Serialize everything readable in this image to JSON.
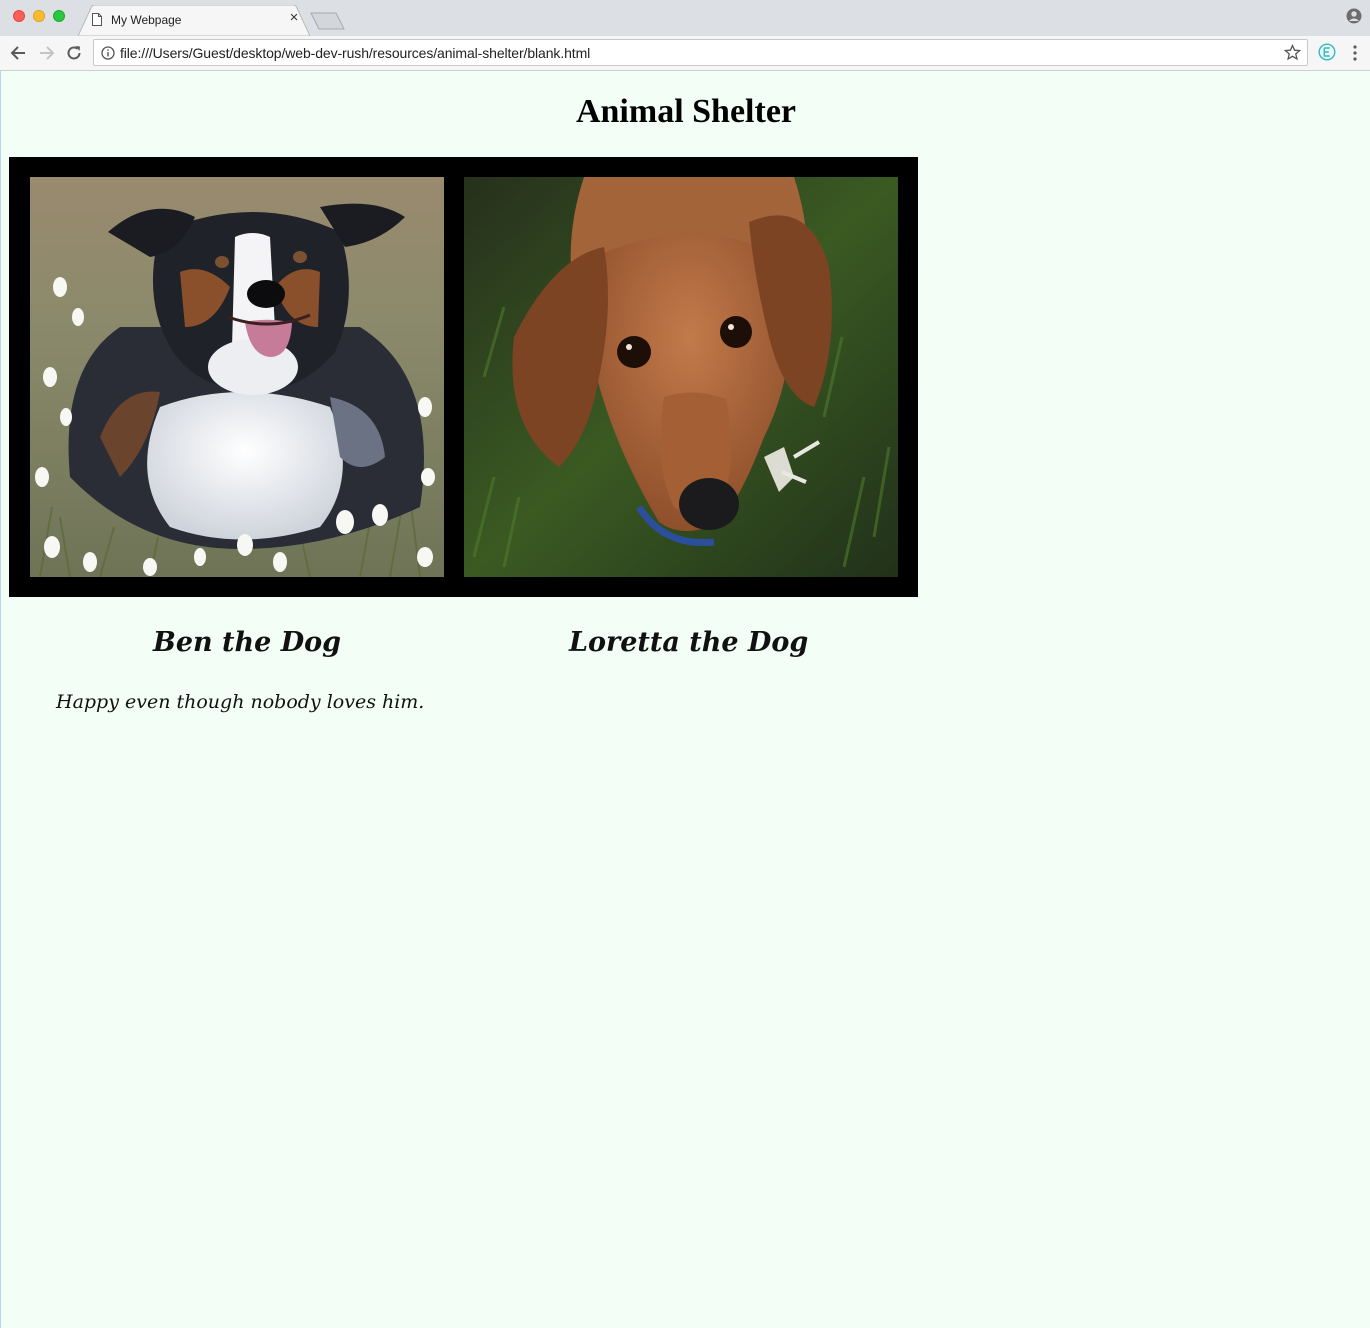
{
  "browser": {
    "tab_title": "My Webpage",
    "tab_close_glyph": "×",
    "url": "file:///Users/Guest/desktop/web-dev-rush/resources/animal-shelter/blank.html",
    "icons": [
      "page-icon",
      "back-icon",
      "forward-icon",
      "reload-icon",
      "info-icon",
      "star-icon",
      "extension-icon",
      "menu-icon",
      "profile-icon"
    ]
  },
  "page": {
    "title": "Animal Shelter",
    "background": "#f3fef7",
    "animals": [
      {
        "name": "Ben the Dog",
        "description": "Happy even though nobody loves him."
      },
      {
        "name": "Loretta the Dog"
      }
    ]
  }
}
